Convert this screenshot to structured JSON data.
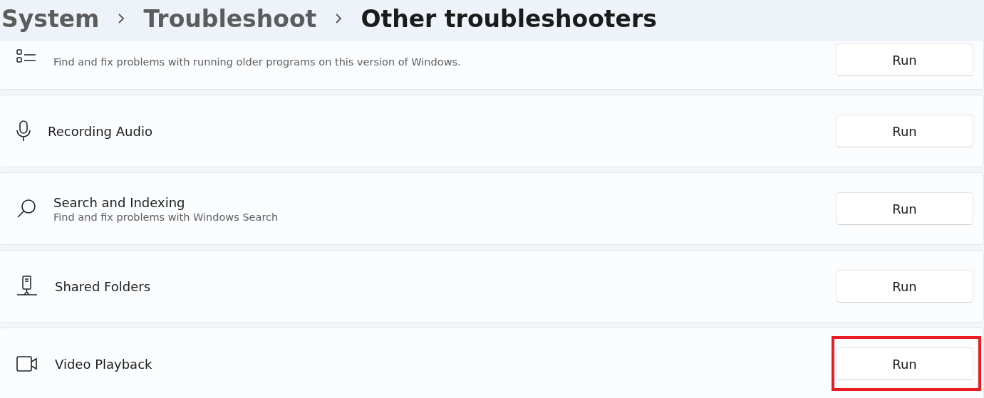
{
  "breadcrumb": [
    {
      "label": "System",
      "current": false
    },
    {
      "label": "Troubleshoot",
      "current": false
    },
    {
      "label": "Other troubleshooters",
      "current": true
    }
  ],
  "troubleshooters": [
    {
      "description": "Find and fix problems with running older programs on this version of Windows.",
      "button": "Run",
      "highlighted": false
    },
    {
      "title": "Recording Audio",
      "button": "Run",
      "highlighted": false
    },
    {
      "title": "Search and Indexing",
      "description": "Find and fix problems with Windows Search",
      "button": "Run",
      "highlighted": false
    },
    {
      "title": "Shared Folders",
      "button": "Run",
      "highlighted": false
    },
    {
      "title": "Video Playback",
      "button": "Run",
      "highlighted": true
    }
  ]
}
